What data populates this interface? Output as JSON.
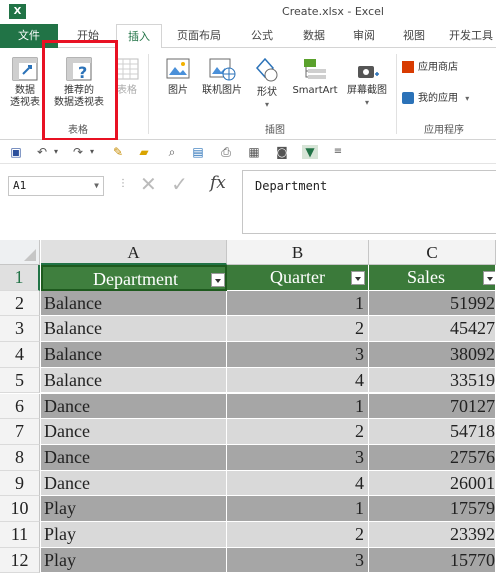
{
  "window": {
    "title": "Create.xlsx - Excel",
    "logo": "X"
  },
  "tabs": [
    {
      "label": "文件"
    },
    {
      "label": "开始"
    },
    {
      "label": "插入"
    },
    {
      "label": "页面布局"
    },
    {
      "label": "公式"
    },
    {
      "label": "数据"
    },
    {
      "label": "审阅"
    },
    {
      "label": "视图"
    },
    {
      "label": "开发工具"
    }
  ],
  "ribbon": {
    "pivot_line1": "数据",
    "pivot_line2": "透视表",
    "recommended_line1": "推荐的",
    "recommended_line2": "数据透视表",
    "table": "表格",
    "picture": "图片",
    "online_picture": "联机图片",
    "shapes": "形状",
    "smartart": "SmartArt",
    "screenshot": "屏幕截图",
    "app_store": "应用商店",
    "my_apps": "我的应用",
    "group_tables": "表格",
    "group_illustrations": "插图",
    "group_apps": "应用程序"
  },
  "formula_bar": {
    "name_box": "A1",
    "fx": "fx",
    "content": "Department"
  },
  "sheet": {
    "columns": [
      "A",
      "B",
      "C"
    ],
    "row_numbers": [
      "1",
      "2",
      "3",
      "4",
      "5",
      "6",
      "7",
      "8",
      "9",
      "10",
      "11",
      "12"
    ],
    "headers": [
      "Department",
      "Quarter",
      "Sales"
    ],
    "rows": [
      [
        "Balance",
        "1",
        "51992"
      ],
      [
        "Balance",
        "2",
        "45427"
      ],
      [
        "Balance",
        "3",
        "38092"
      ],
      [
        "Balance",
        "4",
        "33519"
      ],
      [
        "Dance",
        "1",
        "70127"
      ],
      [
        "Dance",
        "2",
        "54718"
      ],
      [
        "Dance",
        "3",
        "27576"
      ],
      [
        "Dance",
        "4",
        "26001"
      ],
      [
        "Play",
        "1",
        "17579"
      ],
      [
        "Play",
        "2",
        "23392"
      ],
      [
        "Play",
        "3",
        "15770"
      ]
    ]
  },
  "colors": {
    "excel_green": "#217346",
    "highlight_red": "#e81123",
    "header_green": "#3f7f3e"
  }
}
